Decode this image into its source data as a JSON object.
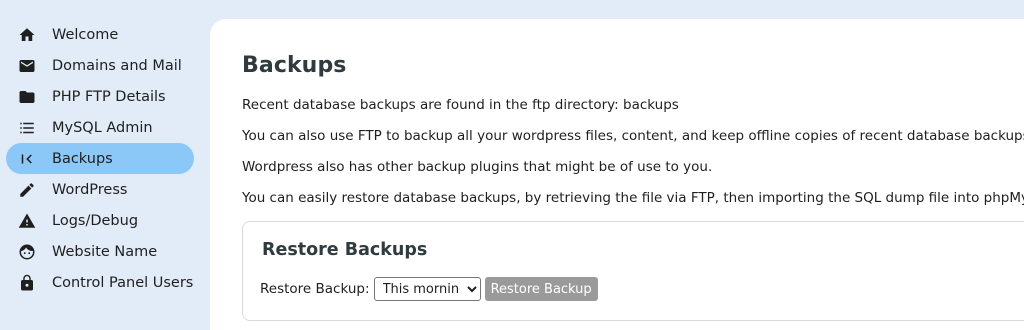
{
  "sidebar": {
    "items": [
      {
        "label": "Welcome",
        "icon": "home-icon",
        "active": false
      },
      {
        "label": "Domains and Mail",
        "icon": "mail-icon",
        "active": false
      },
      {
        "label": "PHP FTP Details",
        "icon": "folder-icon",
        "active": false
      },
      {
        "label": "MySQL Admin",
        "icon": "list-icon",
        "active": false
      },
      {
        "label": "Backups",
        "icon": "collapse-left-icon",
        "active": true
      },
      {
        "label": "WordPress",
        "icon": "pencil-icon",
        "active": false
      },
      {
        "label": "Logs/Debug",
        "icon": "warning-icon",
        "active": false
      },
      {
        "label": "Website Name",
        "icon": "face-icon",
        "active": false
      },
      {
        "label": "Control Panel Users",
        "icon": "lock-icon",
        "active": false
      }
    ]
  },
  "main": {
    "title": "Backups",
    "paragraphs": [
      "Recent database backups are found in the ftp directory: backups",
      "You can also use FTP to backup all your wordpress files, content, and keep offline copies of recent database backups.",
      "Wordpress also has other backup plugins that might be of use to you.",
      "You can easily restore database backups, by retrieving the file via FTP, then importing the SQL dump file into phpMyAdmin."
    ],
    "restore": {
      "title": "Restore Backups",
      "label": "Restore Backup:",
      "selected_option": "This morning",
      "button_label": "Restore Backup"
    }
  },
  "colors": {
    "background": "#e1ecf8",
    "active_nav": "#8bc7f7",
    "button_disabled": "#9a9a9a"
  }
}
